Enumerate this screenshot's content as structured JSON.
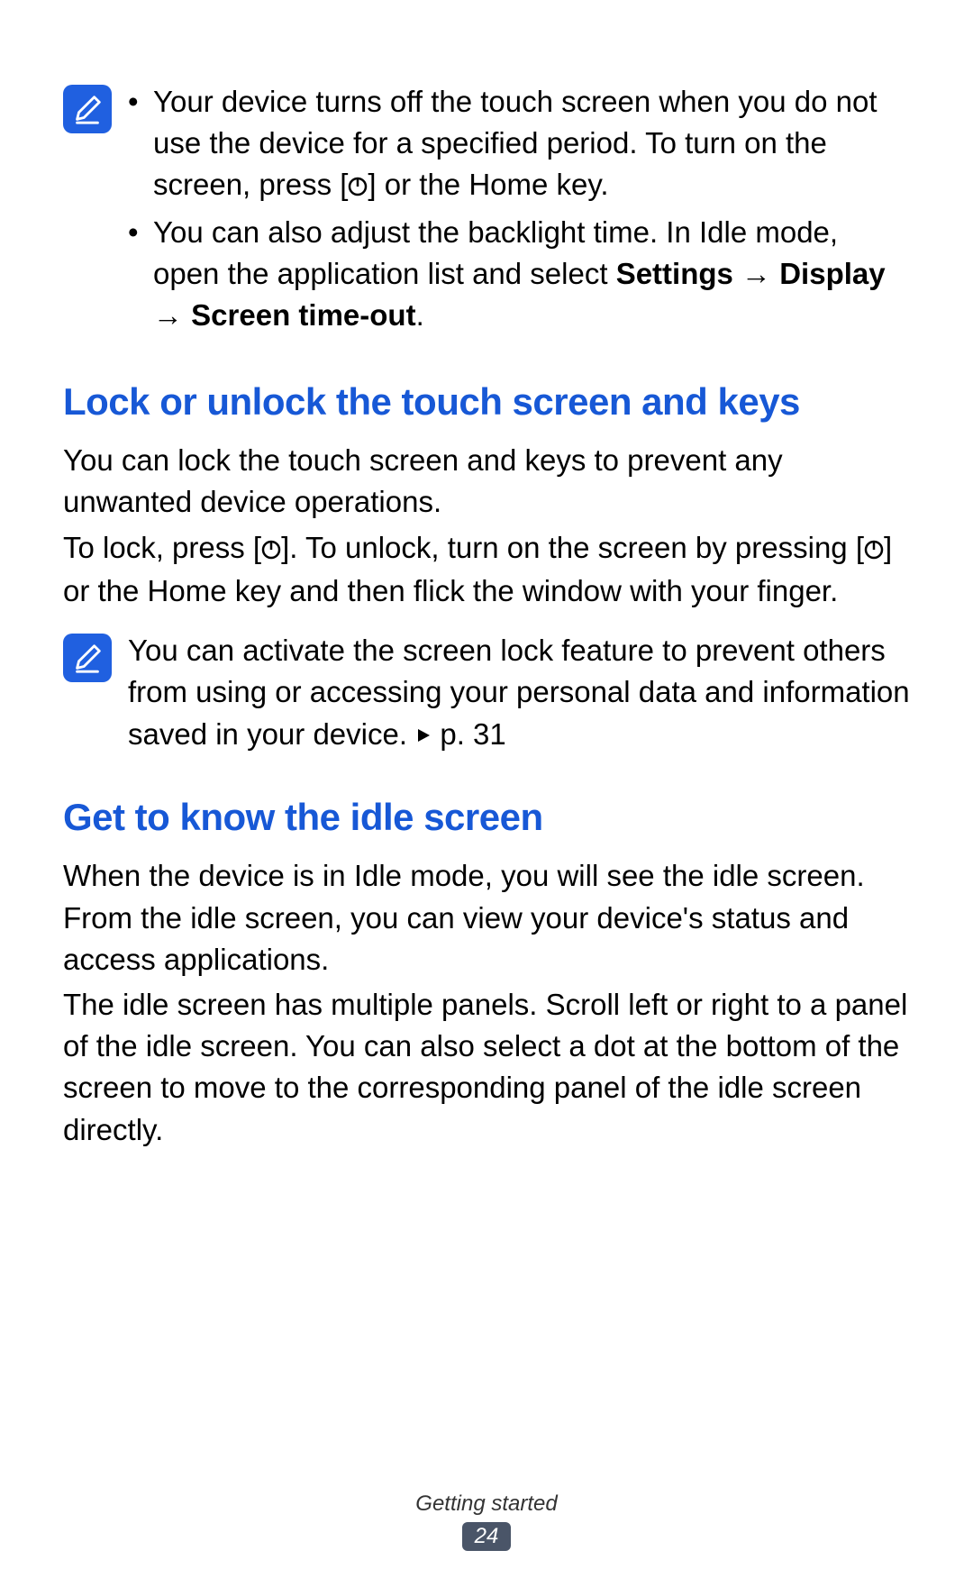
{
  "note1": {
    "bullet1_a": "Your device turns off the touch screen when you do not use the device for a specified period. To turn on the screen, press [",
    "bullet1_b": "] or the Home key.",
    "bullet2_a": "You can also adjust the backlight time. In Idle mode, open the application list and select ",
    "bullet2_settings": "Settings",
    "bullet2_arrow1": " → ",
    "bullet2_display": "Display",
    "bullet2_arrow2": " → ",
    "bullet2_timeout": "Screen time-out",
    "bullet2_period": "."
  },
  "heading1": "Lock or unlock the touch screen and keys",
  "section1": {
    "p1": "You can lock the touch screen and keys to prevent any unwanted device operations.",
    "p2_a": "To lock, press [",
    "p2_b": "]. To unlock, turn on the screen by pressing [",
    "p2_c": "] or the Home key and then flick the window with your finger."
  },
  "note2": {
    "text_a": "You can activate the screen lock feature to prevent others from using or accessing your personal data and information saved in your device. ",
    "text_b": " p. 31"
  },
  "heading2": "Get to know the idle screen",
  "section2": {
    "p1": "When the device is in Idle mode, you will see the idle screen. From the idle screen, you can view your device's status and access applications.",
    "p2": "The idle screen has multiple panels. Scroll left or right to a panel of the idle screen. You can also select a dot at the bottom of the screen to move to the corresponding panel of the idle screen directly."
  },
  "footer": {
    "section": "Getting started",
    "page": "24"
  }
}
